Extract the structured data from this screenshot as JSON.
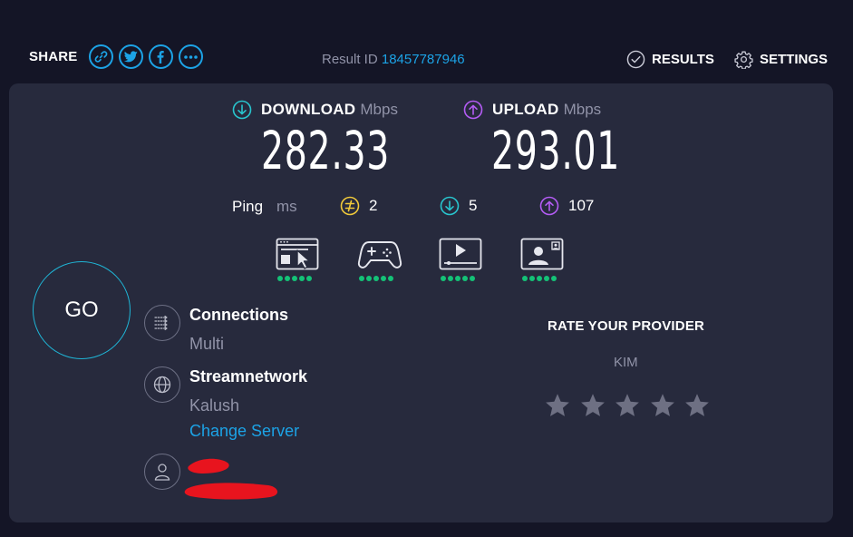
{
  "header": {
    "share_label": "SHARE",
    "share_buttons": [
      {
        "icon": "link-icon"
      },
      {
        "icon": "twitter-icon"
      },
      {
        "icon": "facebook-icon"
      },
      {
        "icon": "more-icon"
      }
    ],
    "result_id_label": "Result ID",
    "result_id_value": "18457787946",
    "results_label": "RESULTS",
    "settings_label": "SETTINGS"
  },
  "metrics": {
    "download": {
      "label": "DOWNLOAD",
      "unit": "Mbps",
      "value": "282.33"
    },
    "upload": {
      "label": "UPLOAD",
      "unit": "Mbps",
      "value": "293.01"
    }
  },
  "ping": {
    "label": "Ping",
    "unit": "ms",
    "idle": "2",
    "download": "5",
    "upload": "107"
  },
  "quality": [
    {
      "icon": "web-browsing-icon",
      "rating": 5
    },
    {
      "icon": "gaming-icon",
      "rating": 5
    },
    {
      "icon": "video-streaming-icon",
      "rating": 5
    },
    {
      "icon": "video-chat-icon",
      "rating": 5
    }
  ],
  "go_label": "GO",
  "connections": {
    "title": "Connections",
    "value": "Multi"
  },
  "server": {
    "title": "Streamnetwork",
    "location": "Kalush",
    "change_label": "Change Server"
  },
  "rating": {
    "title": "RATE YOUR PROVIDER",
    "provider": "KIM",
    "stars": 5
  },
  "colors": {
    "accent_blue": "#1ca3e6",
    "download_teal": "#28c5ce",
    "upload_purple": "#b45cf5",
    "ping_yellow": "#f0c93a",
    "quality_green": "#14c277",
    "panel": "#272a3d",
    "background": "#141526"
  }
}
